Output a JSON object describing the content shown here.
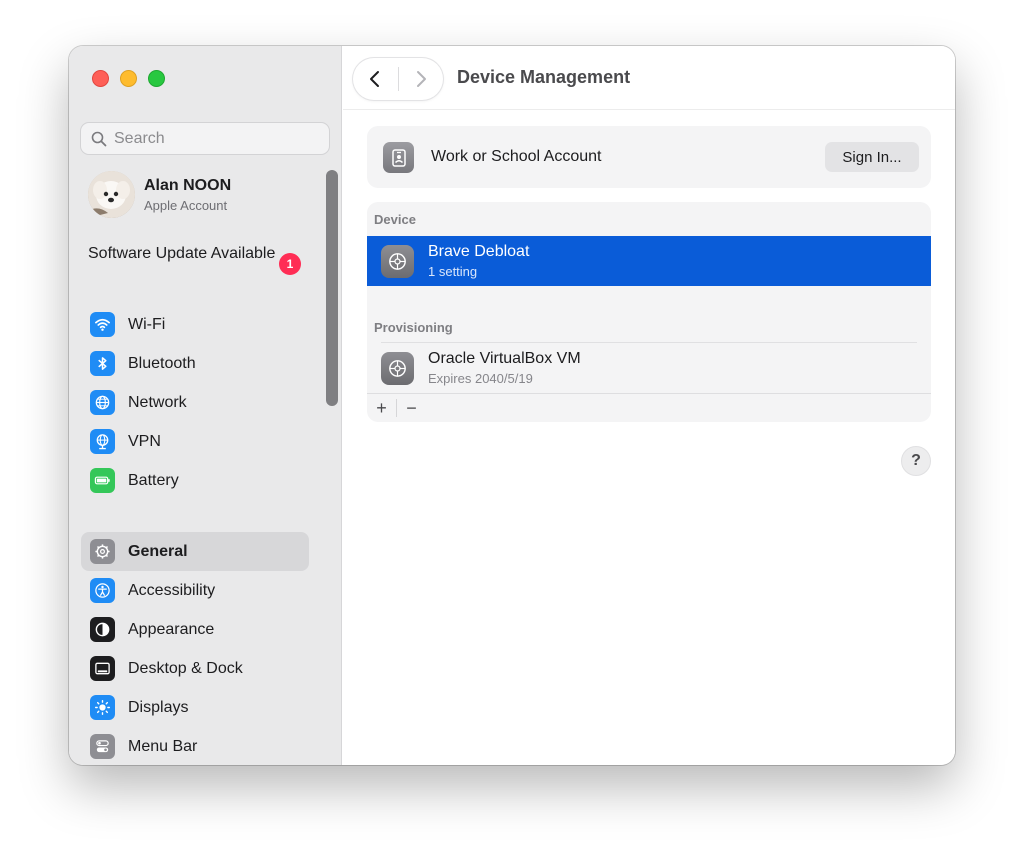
{
  "sidebar": {
    "search_placeholder": "Search",
    "account": {
      "name": "Alan NOON",
      "subtitle": "Apple Account"
    },
    "update": {
      "label": "Software Update Available",
      "badge": "1"
    },
    "items": [
      {
        "label": "Wi-Fi",
        "icon": "wifi-icon",
        "color": "#1f8cf5"
      },
      {
        "label": "Bluetooth",
        "icon": "bluetooth-icon",
        "color": "#1f8cf5"
      },
      {
        "label": "Network",
        "icon": "globe-icon",
        "color": "#1f8cf5"
      },
      {
        "label": "VPN",
        "icon": "vpn-globe-icon",
        "color": "#1f8cf5"
      },
      {
        "label": "Battery",
        "icon": "battery-icon",
        "color": "#34c759"
      },
      {
        "label": "General",
        "icon": "gear-icon",
        "color": "#8e8e93"
      },
      {
        "label": "Accessibility",
        "icon": "accessibility-icon",
        "color": "#1f8cf5"
      },
      {
        "label": "Appearance",
        "icon": "appearance-icon",
        "color": "#1d1d1f"
      },
      {
        "label": "Desktop & Dock",
        "icon": "dock-icon",
        "color": "#1d1d1f"
      },
      {
        "label": "Displays",
        "icon": "sun-icon",
        "color": "#1f8cf5"
      },
      {
        "label": "Menu Bar",
        "icon": "menubar-icon",
        "color": "#8e8e93"
      }
    ],
    "selected": "General"
  },
  "toolbar": {
    "title": "Device Management"
  },
  "account_card": {
    "label": "Work or School Account",
    "button": "Sign In..."
  },
  "device_section": {
    "header": "Device",
    "rows": [
      {
        "title": "Brave Debloat",
        "subtitle": "1 setting"
      }
    ]
  },
  "provisioning_section": {
    "header": "Provisioning",
    "rows": [
      {
        "title": "Oracle VirtualBox VM",
        "subtitle": "Expires 2040/5/19"
      }
    ]
  },
  "footer": {
    "add": "+",
    "remove": "−"
  },
  "help": "?",
  "colors": {
    "accent": "#0a5cd8",
    "badge": "#ff2d55"
  }
}
